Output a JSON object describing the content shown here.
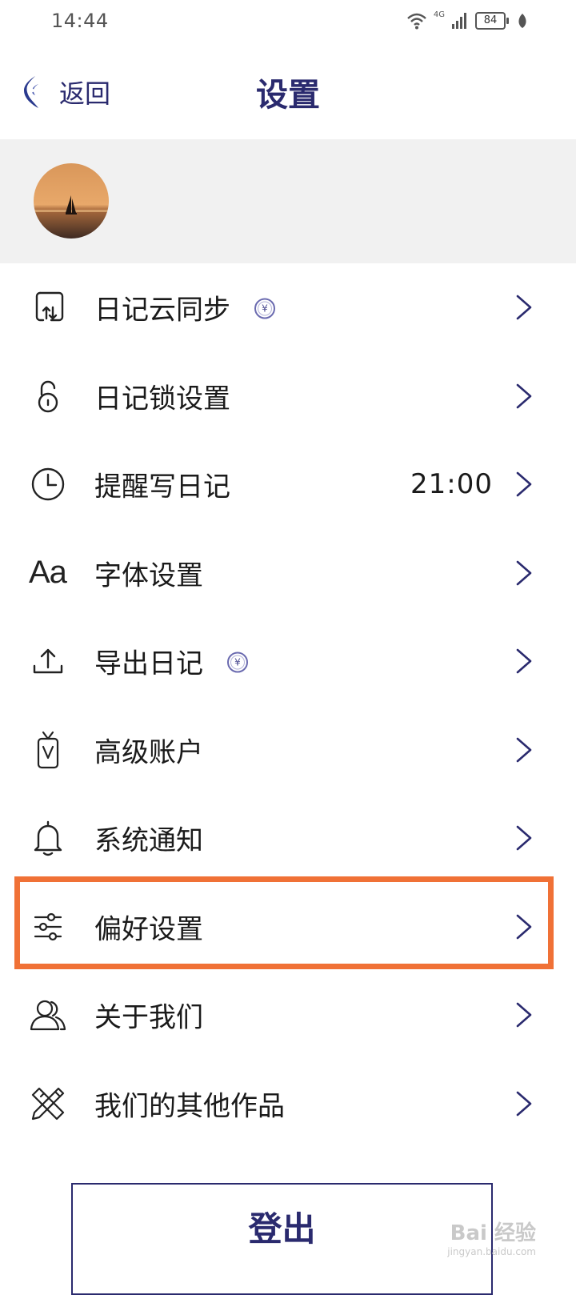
{
  "status_bar": {
    "time": "14:44",
    "network": "4G",
    "battery": "84"
  },
  "header": {
    "back_label": "返回",
    "title": "设置"
  },
  "menu": {
    "items": [
      {
        "label": "日记云同步",
        "icon": "cloud-sync-icon",
        "premium": true,
        "value": ""
      },
      {
        "label": "日记锁设置",
        "icon": "lock-icon",
        "premium": false,
        "value": ""
      },
      {
        "label": "提醒写日记",
        "icon": "clock-icon",
        "premium": false,
        "value": "21:00"
      },
      {
        "label": "字体设置",
        "icon": "font-icon",
        "premium": false,
        "value": ""
      },
      {
        "label": "导出日记",
        "icon": "export-icon",
        "premium": true,
        "value": ""
      },
      {
        "label": "高级账户",
        "icon": "premium-account-icon",
        "premium": false,
        "value": ""
      },
      {
        "label": "系统通知",
        "icon": "bell-icon",
        "premium": false,
        "value": ""
      },
      {
        "label": "偏好设置",
        "icon": "sliders-icon",
        "premium": false,
        "value": ""
      },
      {
        "label": "关于我们",
        "icon": "people-icon",
        "premium": false,
        "value": ""
      },
      {
        "label": "我们的其他作品",
        "icon": "pencil-ruler-icon",
        "premium": false,
        "value": ""
      }
    ],
    "premium_badge": "¥",
    "highlighted_item": "偏好设置"
  },
  "logout_label": "登出",
  "watermark": {
    "text": "Bai 经验",
    "sub": "jingyan.baidu.com"
  },
  "colors": {
    "accent": "#2a2a6e",
    "highlight_border": "#f07136",
    "profile_band": "#f1f1f1"
  }
}
